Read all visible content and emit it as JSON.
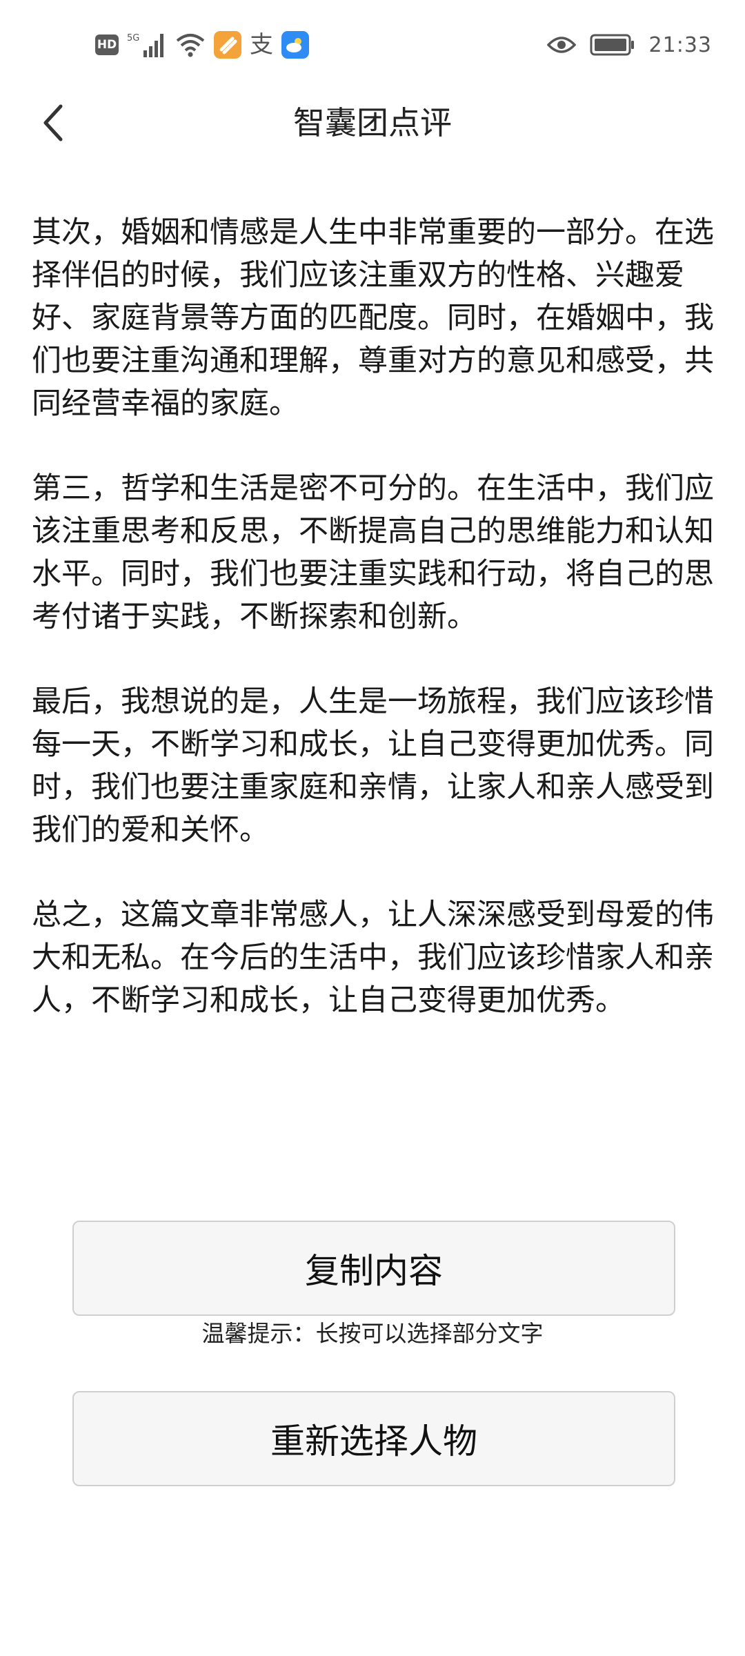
{
  "status_bar": {
    "hd_label": "HD",
    "network_label": "5G",
    "alipay_glyph": "支",
    "time": "21:33",
    "icons": [
      "hd-badge",
      "signal-icon",
      "wifi-icon",
      "orange-app-icon",
      "alipay-icon",
      "weather-app-icon",
      "eye-icon",
      "battery-icon"
    ],
    "colors": {
      "orange_tile": "#f4a23a",
      "blue_tile": "#2f8cf4"
    }
  },
  "header": {
    "back_icon": "chevron-left-icon",
    "title": "智囊团点评"
  },
  "content": {
    "paragraphs": [
      "其次，婚姻和情感是人生中非常重要的一部分。在选择伴侣的时候，我们应该注重双方的性格、兴趣爱好、家庭背景等方面的匹配度。同时，在婚姻中，我们也要注重沟通和理解，尊重对方的意见和感受，共同经营幸福的家庭。",
      "第三，哲学和生活是密不可分的。在生活中，我们应该注重思考和反思，不断提高自己的思维能力和认知水平。同时，我们也要注重实践和行动，将自己的思考付诸于实践，不断探索和创新。",
      "最后，我想说的是，人生是一场旅程，我们应该珍惜每一天，不断学习和成长，让自己变得更加优秀。同时，我们也要注重家庭和亲情，让家人和亲人感受到我们的爱和关怀。",
      "总之，这篇文章非常感人，让人深深感受到母爱的伟大和无私。在今后的生活中，我们应该珍惜家人和亲人，不断学习和成长，让自己变得更加优秀。"
    ]
  },
  "actions": {
    "copy_label": "复制内容",
    "hint": "温馨提示：长按可以选择部分文字",
    "reselect_label": "重新选择人物"
  }
}
